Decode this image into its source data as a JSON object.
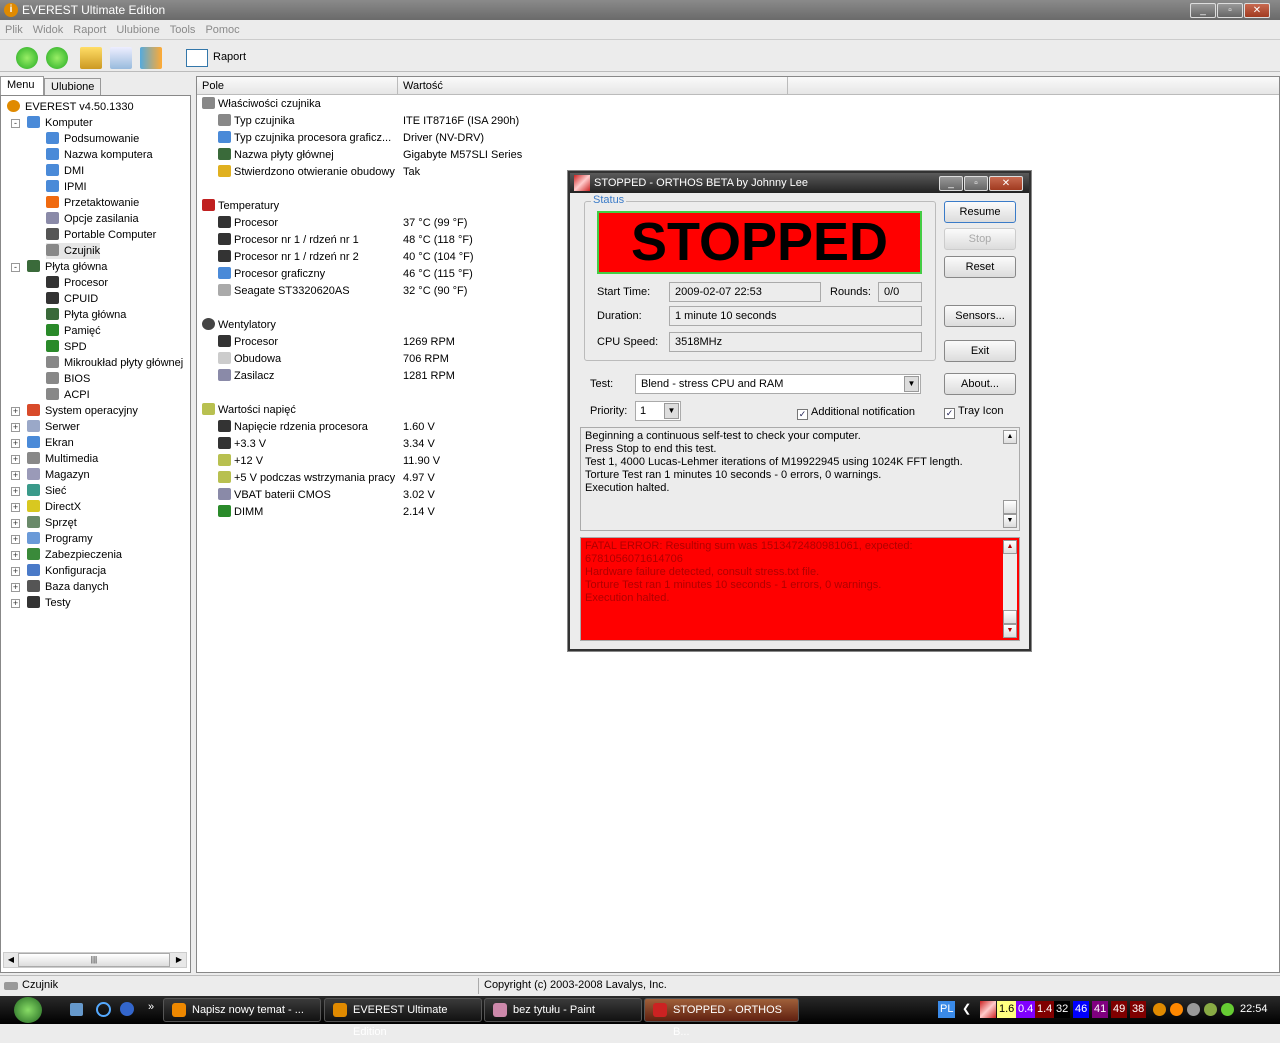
{
  "window": {
    "title": "EVEREST Ultimate Edition",
    "controls": [
      "_",
      "▫",
      "✕"
    ]
  },
  "menu": [
    "Plik",
    "Widok",
    "Raport",
    "Ulubione",
    "Tools",
    "Pomoc"
  ],
  "toolbar": {
    "report_label": "Raport"
  },
  "tabs": [
    "Menu",
    "Ulubione"
  ],
  "tree": [
    {
      "label": "EVEREST v4.50.1330",
      "level": 0,
      "icon": "info-icon",
      "color": "#e08a00"
    },
    {
      "label": "Komputer",
      "level": 1,
      "exp": "-",
      "icon": "computer-icon",
      "color": "#4a8ad8"
    },
    {
      "label": "Podsumowanie",
      "level": 2,
      "icon": "computer-icon",
      "color": "#4a8ad8"
    },
    {
      "label": "Nazwa komputera",
      "level": 2,
      "icon": "computer-icon",
      "color": "#4a8ad8"
    },
    {
      "label": "DMI",
      "level": 2,
      "icon": "computer-icon",
      "color": "#4a8ad8"
    },
    {
      "label": "IPMI",
      "level": 2,
      "icon": "computer-icon",
      "color": "#4a8ad8"
    },
    {
      "label": "Przetaktowanie",
      "level": 2,
      "icon": "flame-icon",
      "color": "#f06a10"
    },
    {
      "label": "Opcje zasilania",
      "level": 2,
      "icon": "power-icon",
      "color": "#8a8aa8"
    },
    {
      "label": "Portable Computer",
      "level": 2,
      "icon": "laptop-icon",
      "color": "#555"
    },
    {
      "label": "Czujnik",
      "level": 2,
      "icon": "chip-icon",
      "color": "#888",
      "selected": true
    },
    {
      "label": "Płyta główna",
      "level": 1,
      "exp": "-",
      "icon": "motherboard-icon",
      "color": "#3a6a3a"
    },
    {
      "label": "Procesor",
      "level": 2,
      "icon": "cpu-icon",
      "color": "#333"
    },
    {
      "label": "CPUID",
      "level": 2,
      "icon": "cpu-icon",
      "color": "#333"
    },
    {
      "label": "Płyta główna",
      "level": 2,
      "icon": "motherboard-icon",
      "color": "#3a6a3a"
    },
    {
      "label": "Pamięć",
      "level": 2,
      "icon": "memory-icon",
      "color": "#2a8a2a"
    },
    {
      "label": "SPD",
      "level": 2,
      "icon": "memory-icon",
      "color": "#2a8a2a"
    },
    {
      "label": "Mikroukład płyty głównej",
      "level": 2,
      "icon": "chip-icon",
      "color": "#888"
    },
    {
      "label": "BIOS",
      "level": 2,
      "icon": "chip-icon",
      "color": "#888"
    },
    {
      "label": "ACPI",
      "level": 2,
      "icon": "chip-icon",
      "color": "#888"
    },
    {
      "label": "System operacyjny",
      "level": 1,
      "exp": "+",
      "icon": "windows-icon",
      "color": "#d84a2a"
    },
    {
      "label": "Serwer",
      "level": 1,
      "exp": "+",
      "icon": "server-icon",
      "color": "#9aa8c8"
    },
    {
      "label": "Ekran",
      "level": 1,
      "exp": "+",
      "icon": "monitor-icon",
      "color": "#4a8ad8"
    },
    {
      "label": "Multimedia",
      "level": 1,
      "exp": "+",
      "icon": "speaker-icon",
      "color": "#888"
    },
    {
      "label": "Magazyn",
      "level": 1,
      "exp": "+",
      "icon": "storage-icon",
      "color": "#9a9ab8"
    },
    {
      "label": "Sieć",
      "level": 1,
      "exp": "+",
      "icon": "network-icon",
      "color": "#3a9a8a"
    },
    {
      "label": "DirectX",
      "level": 1,
      "exp": "+",
      "icon": "directx-icon",
      "color": "#d8c820"
    },
    {
      "label": "Sprzęt",
      "level": 1,
      "exp": "+",
      "icon": "devices-icon",
      "color": "#6a8a6a"
    },
    {
      "label": "Programy",
      "level": 1,
      "exp": "+",
      "icon": "programs-icon",
      "color": "#6a9ad8"
    },
    {
      "label": "Zabezpieczenia",
      "level": 1,
      "exp": "+",
      "icon": "shield-icon",
      "color": "#3a8a3a"
    },
    {
      "label": "Konfiguracja",
      "level": 1,
      "exp": "+",
      "icon": "config-icon",
      "color": "#4a7ac8"
    },
    {
      "label": "Baza danych",
      "level": 1,
      "exp": "+",
      "icon": "database-icon",
      "color": "#555"
    },
    {
      "label": "Testy",
      "level": 1,
      "exp": "+",
      "icon": "hourglass-icon",
      "color": "#333"
    }
  ],
  "list": {
    "columns": [
      "Pole",
      "Wartość"
    ],
    "rows": [
      {
        "field": "Właściwości czujnika",
        "group": true,
        "icon": "chip-icon",
        "color": "#888"
      },
      {
        "field": "Typ czujnika",
        "value": "ITE IT8716F  (ISA 290h)",
        "icon": "chip-icon",
        "color": "#888"
      },
      {
        "field": "Typ czujnika procesora graficz...",
        "value": "Driver  (NV-DRV)",
        "icon": "monitor-icon",
        "color": "#4a8ad8"
      },
      {
        "field": "Nazwa płyty głównej",
        "value": "Gigabyte M57SLI Series",
        "icon": "motherboard-icon",
        "color": "#3a6a3a"
      },
      {
        "field": "Stwierdzono otwieranie obudowy",
        "value": "Tak",
        "icon": "lock-icon",
        "color": "#e0b020"
      },
      {
        "spacer": true
      },
      {
        "field": "Temperatury",
        "group": true,
        "icon": "thermometer-icon",
        "color": "#c02020"
      },
      {
        "field": "Procesor",
        "value": "37 °C  (99 °F)",
        "icon": "cpu-icon",
        "color": "#333"
      },
      {
        "field": "Procesor nr 1 / rdzeń nr 1",
        "value": "48 °C  (118 °F)",
        "icon": "cpu-icon",
        "color": "#333"
      },
      {
        "field": "Procesor nr 1 / rdzeń nr 2",
        "value": "40 °C  (104 °F)",
        "icon": "cpu-icon",
        "color": "#333"
      },
      {
        "field": "Procesor graficzny",
        "value": "46 °C  (115 °F)",
        "icon": "monitor-icon",
        "color": "#4a8ad8"
      },
      {
        "field": "Seagate ST3320620AS",
        "value": "32 °C  (90 °F)",
        "icon": "harddisk-icon",
        "color": "#aaa"
      },
      {
        "spacer": true
      },
      {
        "field": "Wentylatory",
        "group": true,
        "icon": "fan-icon",
        "color": "#444"
      },
      {
        "field": "Procesor",
        "value": "1269 RPM",
        "icon": "cpu-icon",
        "color": "#333"
      },
      {
        "field": "Obudowa",
        "value": "706 RPM",
        "icon": "case-icon",
        "color": "#ccc"
      },
      {
        "field": "Zasilacz",
        "value": "1281 RPM",
        "icon": "power-icon",
        "color": "#8a8aa8"
      },
      {
        "spacer": true
      },
      {
        "field": "Wartości napięć",
        "group": true,
        "icon": "voltage-icon",
        "color": "#b8c050"
      },
      {
        "field": "Napięcie rdzenia procesora",
        "value": "1.60 V",
        "icon": "cpu-icon",
        "color": "#333"
      },
      {
        "field": "+3.3 V",
        "value": "3.34 V",
        "icon": "cpu-icon",
        "color": "#333"
      },
      {
        "field": "+12 V",
        "value": "11.90 V",
        "icon": "voltage-icon",
        "color": "#b8c050"
      },
      {
        "field": "+5 V podczas wstrzymania pracy",
        "value": "4.97 V",
        "icon": "voltage-icon",
        "color": "#b8c050"
      },
      {
        "field": "VBAT baterii CMOS",
        "value": "3.02 V",
        "icon": "power-icon",
        "color": "#8a8aa8"
      },
      {
        "field": "DIMM",
        "value": "2.14 V",
        "icon": "memory-icon",
        "color": "#2a8a2a"
      }
    ]
  },
  "statusbar": {
    "left": "Czujnik",
    "right": "Copyright (c) 2003-2008 Lavalys, Inc."
  },
  "orthos": {
    "title": "STOPPED - ORTHOS BETA by Johnny Lee",
    "status_group": "Status",
    "banner": "STOPPED",
    "banner_color": "#ff0000",
    "start_time_label": "Start Time:",
    "start_time": "2009-02-07 22:53",
    "rounds_label": "Rounds:",
    "rounds": "0/0",
    "duration_label": "Duration:",
    "duration": "1 minute 10 seconds",
    "cpu_speed_label": "CPU Speed:",
    "cpu_speed": "3518MHz",
    "test_label": "Test:",
    "test_value": "Blend - stress CPU and RAM",
    "priority_label": "Priority:",
    "priority_value": "1",
    "additional_notification": "Additional notification",
    "tray_icon": "Tray Icon",
    "buttons": {
      "resume": "Resume",
      "stop": "Stop",
      "reset": "Reset",
      "sensors": "Sensors...",
      "exit": "Exit",
      "about": "About..."
    },
    "log1": [
      "Beginning a continuous self-test to check your computer.",
      "Press Stop to end this test.",
      "Test 1, 4000 Lucas-Lehmer iterations of M19922945 using 1024K FFT length.",
      "Torture Test ran 1 minutes 10 seconds - 0 errors, 0 warnings.",
      "Execution halted."
    ],
    "log2": [
      "FATAL ERROR: Resulting sum was 1513472480981061, expected:",
      "6781056071614706",
      "Hardware failure detected, consult stress.txt file.",
      "Torture Test ran 1 minutes 10 seconds - 1 errors, 0 warnings.",
      "Execution halted."
    ]
  },
  "taskbar": {
    "tasks": [
      {
        "label": "Napisz nowy temat - ..."
      },
      {
        "label": "EVEREST Ultimate Edition"
      },
      {
        "label": "bez tytułu - Paint"
      },
      {
        "label": "STOPPED - ORTHOS B..."
      }
    ],
    "language": "PL",
    "tray_values": [
      {
        "v": "1.6",
        "bg": "#ffff80",
        "fg": "#000"
      },
      {
        "v": "0.4",
        "bg": "#8000ff",
        "fg": "#fff"
      },
      {
        "v": "1.4",
        "bg": "#800000",
        "fg": "#fff"
      },
      {
        "v": "32",
        "bg": "#000",
        "fg": "#fff"
      },
      {
        "v": "46",
        "bg": "#0000ff",
        "fg": "#fff"
      },
      {
        "v": "41",
        "bg": "#800080",
        "fg": "#fff"
      },
      {
        "v": "49",
        "bg": "#800000",
        "fg": "#fff"
      },
      {
        "v": "38",
        "bg": "#800000",
        "fg": "#fff"
      }
    ],
    "clock": "22:54"
  }
}
